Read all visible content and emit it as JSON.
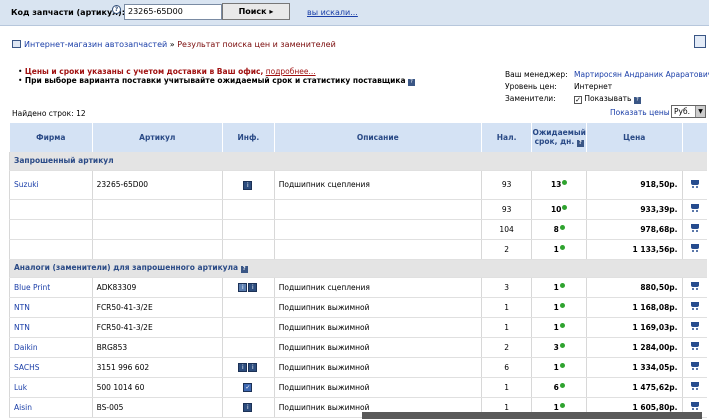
{
  "topbar": {
    "search_label": "Код запчасти (артикул):",
    "help_icon": "?",
    "search_value": "23265-65D00",
    "search_button": "Поиск ▸",
    "searched_link": "вы искали..."
  },
  "breadcrumb": {
    "root": "Интернет-магазин автозапчастей",
    "sep": " » ",
    "current": "Результат поиска цен и заменителей"
  },
  "notes": {
    "line1_red": "Цены и сроки указаны с учетом доставки в Ваш офис,",
    "line1_link": "подробнее...",
    "line2": "При выборе варианта поставки учитывайте ожидаемый срок и статистику поставщика"
  },
  "manager": {
    "manager_label": "Ваш менеджер:",
    "manager_value": "Мартиросян Андраник Араратович",
    "price_label": "Уровень цен:",
    "price_value": "Интернет",
    "subs_label": "Заменители:",
    "subs_value": "Показывать"
  },
  "found": "Найдено строк: 12",
  "currency": {
    "label": "Показать цены в",
    "value": "Руб."
  },
  "table": {
    "headers": {
      "firm": "Фирма",
      "article": "Артикул",
      "info": "Инф.",
      "desc": "Описание",
      "avail": "Нал.",
      "term": "Ожидаемый срок, дн.",
      "price": "Цена"
    },
    "section1": "Запрошенный артикул",
    "requested": [
      {
        "firm": "Suzuki",
        "article": "23265-65D00",
        "desc": "Подшипник сцепления",
        "avail": "93",
        "term": "13",
        "price": "918,50р."
      },
      {
        "firm": "",
        "article": "",
        "desc": "",
        "avail": "93",
        "term": "10",
        "price": "933,39р."
      },
      {
        "firm": "",
        "article": "",
        "desc": "",
        "avail": "104",
        "term": "8",
        "price": "978,68р."
      },
      {
        "firm": "",
        "article": "",
        "desc": "",
        "avail": "2",
        "term": "1",
        "price": "1 133,56р."
      }
    ],
    "section2": "Аналоги (заменители) для запрошенного артикула",
    "analogs": [
      {
        "firm": "Blue Print",
        "article": "ADK83309",
        "desc": "Подшипник сцепления",
        "avail": "3",
        "term": "1",
        "price": "880,50р."
      },
      {
        "firm": "NTN",
        "article": "FCR50-41-3/2E",
        "desc": "Подшипник выжимной",
        "avail": "1",
        "term": "1",
        "price": "1 168,08р."
      },
      {
        "firm": "NTN",
        "article": "FCR50-41-3/2E",
        "desc": "Подшипник выжимной",
        "avail": "1",
        "term": "1",
        "price": "1 169,03р."
      },
      {
        "firm": "Daikin",
        "article": "BRG853",
        "desc": "Подшипник выжимной",
        "avail": "2",
        "term": "3",
        "price": "1 284,00р."
      },
      {
        "firm": "SACHS",
        "article": "3151 996 602",
        "desc": "Подшипник выжимной",
        "avail": "6",
        "term": "1",
        "price": "1 334,05р."
      },
      {
        "firm": "Luk",
        "article": "500 1014 60",
        "desc": "Подшипник выжимной",
        "avail": "1",
        "term": "6",
        "price": "1 475,62р."
      },
      {
        "firm": "Aisin",
        "article": "BS-005",
        "desc": "Подшипник выжимной",
        "avail": "1",
        "term": "1",
        "price": "1 605,80р."
      }
    ]
  },
  "colors": {
    "accent": "#1a3ea8",
    "header_bg": "#d4e2f4",
    "topbar_bg": "#d9e4f1",
    "status_green": "#2fa32f"
  }
}
